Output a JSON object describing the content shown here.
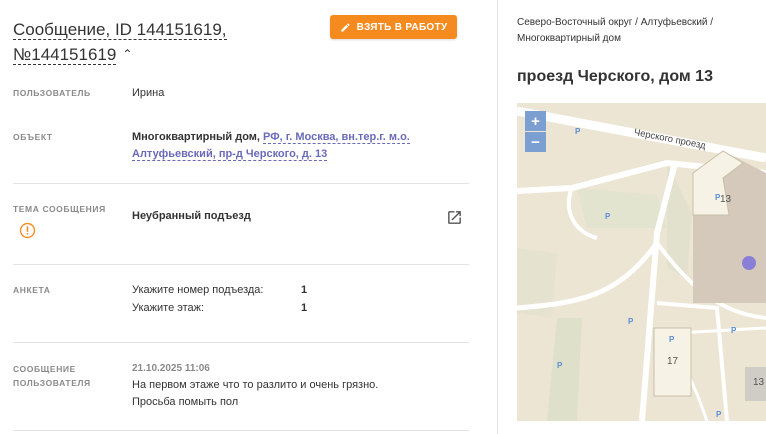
{
  "message": {
    "title_line1": "Сообщение, ID 144151619,",
    "title_line2": "№144151619",
    "take_button": "ВЗЯТЬ В РАБОТУ"
  },
  "fields": {
    "user_label": "ПОЛЬЗОВАТЕЛЬ",
    "user_value": "Ирина",
    "object_label": "ОБЪЕКТ",
    "object_type": "Многоквартирный дом,",
    "object_addr_line1": "РФ, г. Москва, вн.тер.г. м.о.",
    "object_addr_line2": "Алтуфьевский, пр-д Черского, д. 13",
    "topic_label": "ТЕМА СООБЩЕНИЯ",
    "topic_value": "Неубранный подъезд",
    "survey_label": "АНКЕТА",
    "survey": [
      {
        "q": "Укажите номер подъезда:",
        "a": "1"
      },
      {
        "q": "Укажите этаж:",
        "a": "1"
      }
    ],
    "message_label_1": "СООБЩЕНИЕ",
    "message_label_2": "ПОЛЬЗОВАТЕЛЯ",
    "message_date": "21.10.2025 11:06",
    "message_text_1": "На первом этаже что то разлито и очень грязно.",
    "message_text_2": "Просьба помыть пол"
  },
  "side": {
    "breadcrumb_1": "Северо-Восточный округ / Алтуфьевский /",
    "breadcrumb_2": "Многоквартирный дом",
    "address": "проезд Черского, дом 13"
  },
  "map": {
    "zoom_in": "+",
    "zoom_out": "−",
    "street_label": "Черского проезд",
    "building_13": "13",
    "building_17": "17",
    "building_13b": "13",
    "parking": "P",
    "marker_color": "#8a7fd6"
  },
  "colors": {
    "accent": "#f58a1f",
    "link": "#6a6ab8",
    "warning": "#f58a1f"
  }
}
